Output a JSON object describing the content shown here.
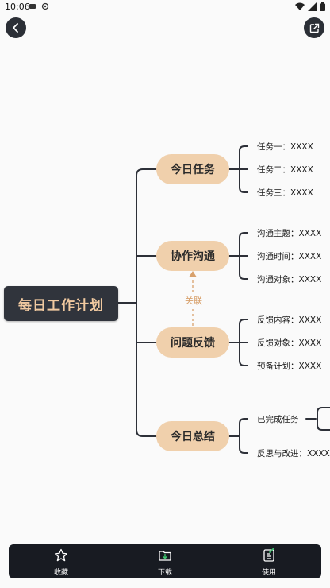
{
  "status_bar": {
    "time": "10:06"
  },
  "mindmap": {
    "central": "每日工作计划",
    "branches": [
      {
        "label": "今日任务",
        "leaves": [
          "任务一：XXXX",
          "任务二：XXXX",
          "任务三：XXXX"
        ]
      },
      {
        "label": "协作沟通",
        "leaves": [
          "沟通主题：XXXX",
          "沟通时间：XXXX",
          "沟通对象：XXXX"
        ]
      },
      {
        "label": "问题反馈",
        "leaves": [
          "反馈内容：XXXX",
          "反馈对象：XXXX",
          "预备计划：XXXX"
        ]
      },
      {
        "label": "今日总结",
        "leaves": [
          "已完成任务",
          "反思与改进：XXXX"
        ]
      }
    ],
    "relation_label": "关联"
  },
  "bottom_nav": {
    "favorite": "收藏",
    "download": "下载",
    "use": "使用"
  },
  "colors": {
    "accent": "#f0d0ac",
    "central_bg": "#30343c",
    "central_text": "#f0c9a0",
    "relation": "#d8a16c"
  }
}
